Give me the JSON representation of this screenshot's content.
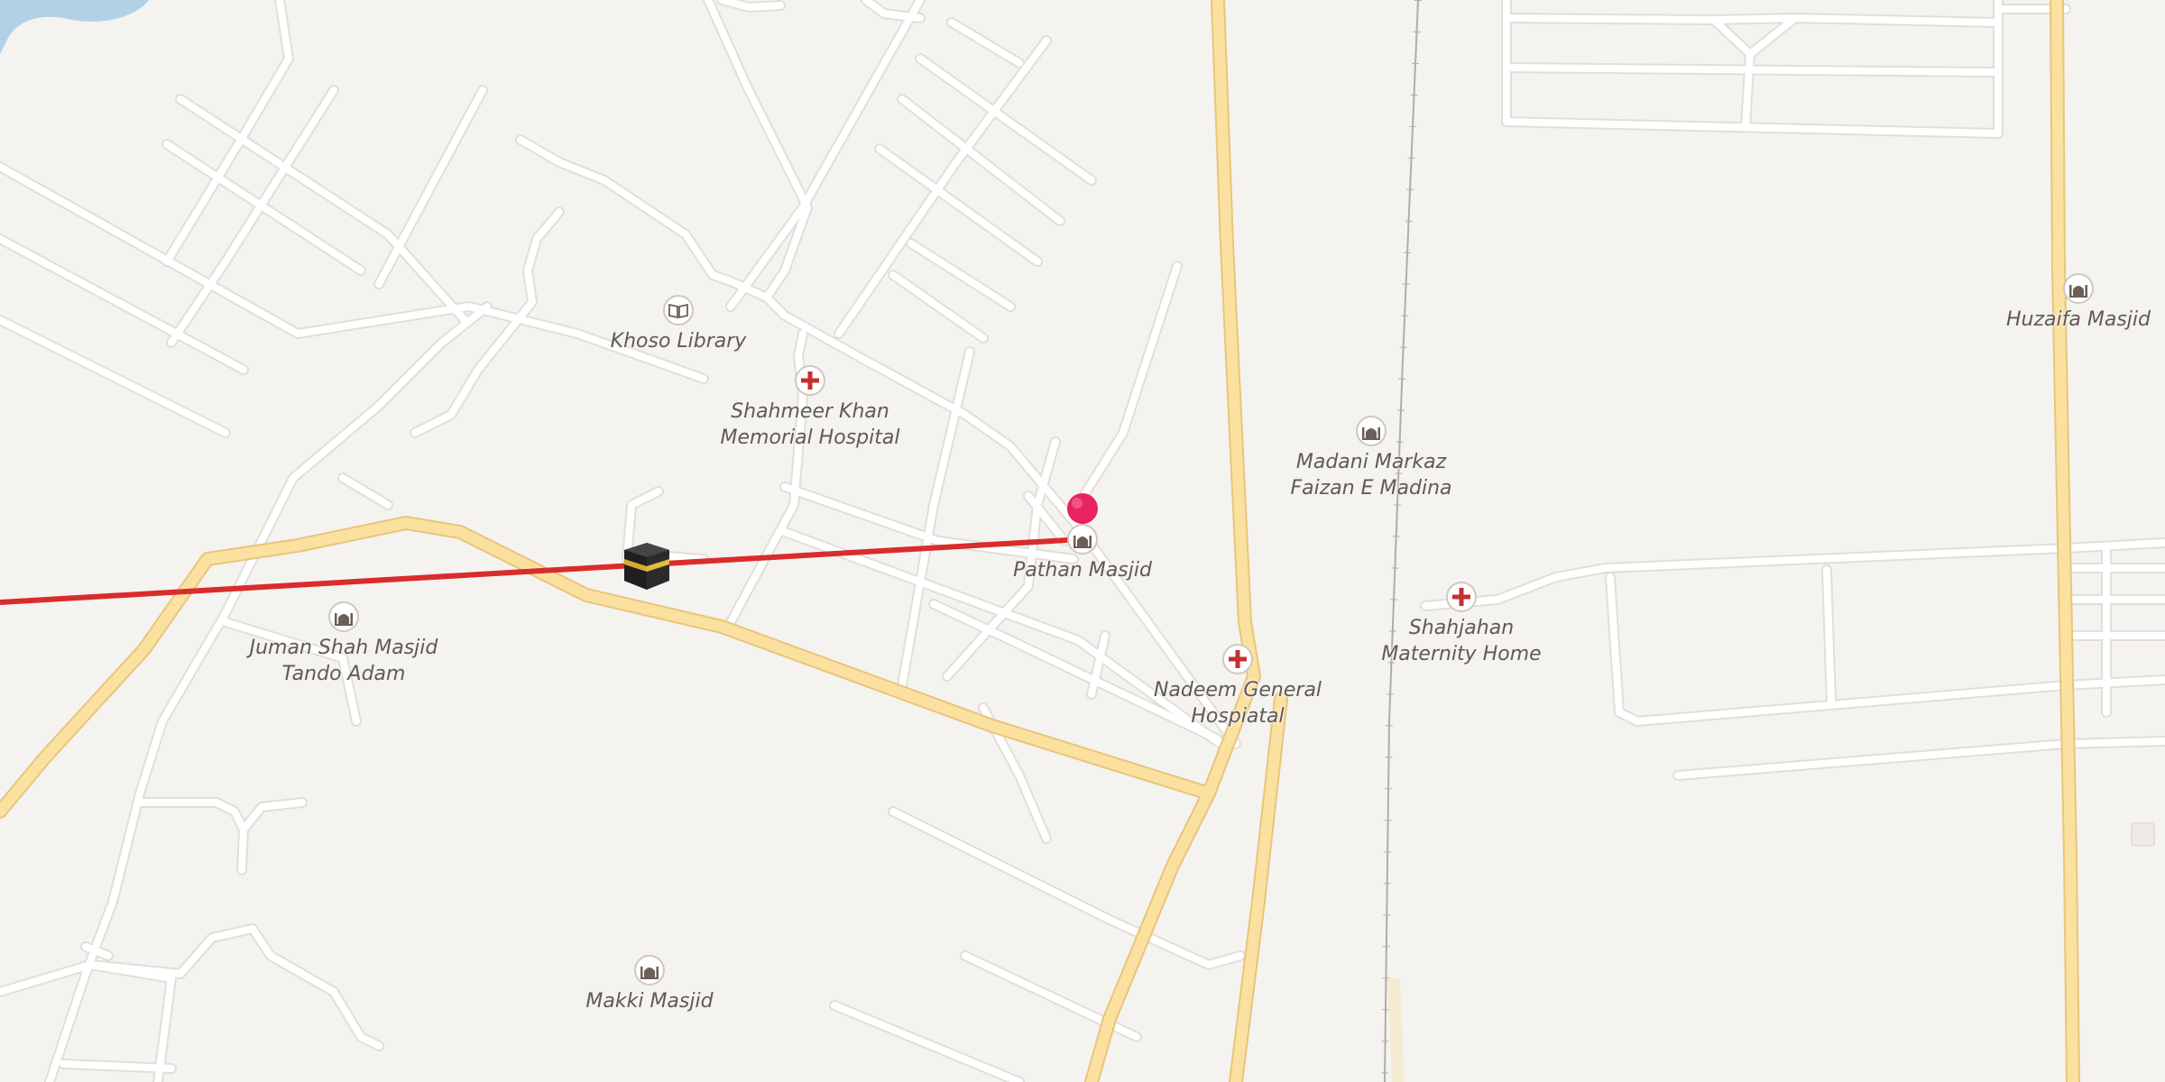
{
  "map": {
    "colors": {
      "background": "#f5f3f0",
      "water": "#b3d1e6",
      "minor_road": "#ffffff",
      "minor_road_casing": "#e2ded8",
      "major_road": "#fbe1a0",
      "major_road_casing": "#e8c57c",
      "railway": "#b0aca7",
      "qibla_line": "#d92c2c",
      "pin": "#e8235f",
      "hospital_cross": "#c62f2f",
      "poi_icon": "#6b5f58"
    },
    "pois": [
      {
        "id": "khoso-library",
        "icon": "book-icon",
        "label_lines": [
          "Khoso Library"
        ]
      },
      {
        "id": "shahmeer-khan-hospital",
        "icon": "hospital-cross-icon",
        "label_lines": [
          "Shahmeer Khan",
          "Memorial Hospital"
        ]
      },
      {
        "id": "madani-markaz",
        "icon": "mosque-icon",
        "label_lines": [
          "Madani Markaz",
          "Faizan E Madina"
        ]
      },
      {
        "id": "huzaifa-masjid",
        "icon": "mosque-icon",
        "label_lines": [
          "Huzaifa Masjid"
        ]
      },
      {
        "id": "pathan-masjid",
        "icon": "mosque-icon",
        "label_lines": [
          "Pathan Masjid"
        ]
      },
      {
        "id": "shahjahan-maternity",
        "icon": "hospital-cross-icon",
        "label_lines": [
          "Shahjahan",
          "Maternity Home"
        ]
      },
      {
        "id": "nadeem-general-hospital",
        "icon": "hospital-cross-icon",
        "label_lines": [
          "Nadeem General",
          "Hospiatal"
        ]
      },
      {
        "id": "juman-shah-masjid",
        "icon": "mosque-icon",
        "label_lines": [
          "Juman Shah Masjid",
          "Tando Adam"
        ]
      },
      {
        "id": "makki-masjid",
        "icon": "mosque-icon",
        "label_lines": [
          "Makki Masjid"
        ]
      }
    ],
    "markers": {
      "location_pin": "map-pin-icon",
      "qibla_marker": "kaaba-icon"
    }
  }
}
